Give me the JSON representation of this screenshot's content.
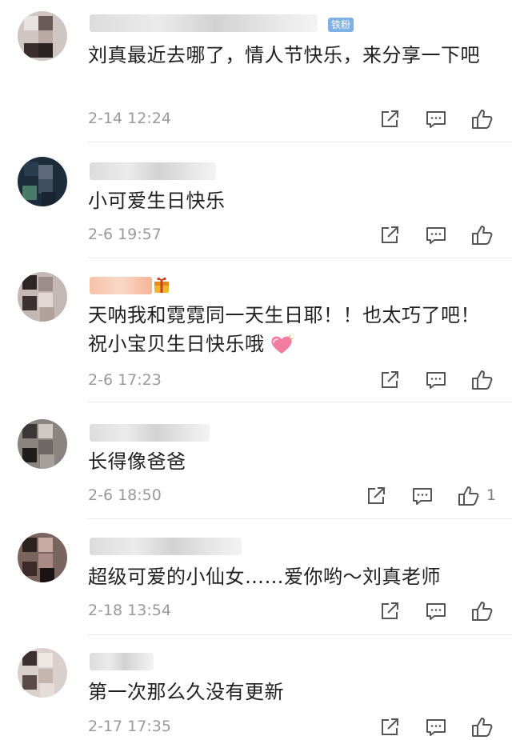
{
  "comments": [
    {
      "badge": "铁粉",
      "text": "刘真最近去哪了，情人节快乐，来分享一下吧",
      "time": "2-14 12:24",
      "likes": ""
    },
    {
      "text": "小可爱生日快乐",
      "time": "2-6 19:57",
      "likes": ""
    },
    {
      "text": "天呐我和霓霓同一天生日耶！！也太巧了吧！祝小宝贝生日快乐哦",
      "time": "2-6 17:23",
      "likes": "",
      "emoji": "heart-emoji"
    },
    {
      "text": "长得像爸爸",
      "time": "2-6 18:50",
      "likes": "1"
    },
    {
      "text": "超级可爱的小仙女……爱你哟～刘真老师",
      "time": "2-18 13:54",
      "likes": ""
    },
    {
      "text": "第一次那么久没有更新",
      "time": "2-17 17:35",
      "likes": ""
    }
  ],
  "icons": {
    "share": "share-icon",
    "reply": "comment-icon",
    "like": "thumbs-up-icon"
  },
  "colors": {
    "text": "#1f1f1f",
    "meta": "#9a9a9a",
    "badge": "#7fb0e6",
    "divider": "#e6e6e6"
  }
}
